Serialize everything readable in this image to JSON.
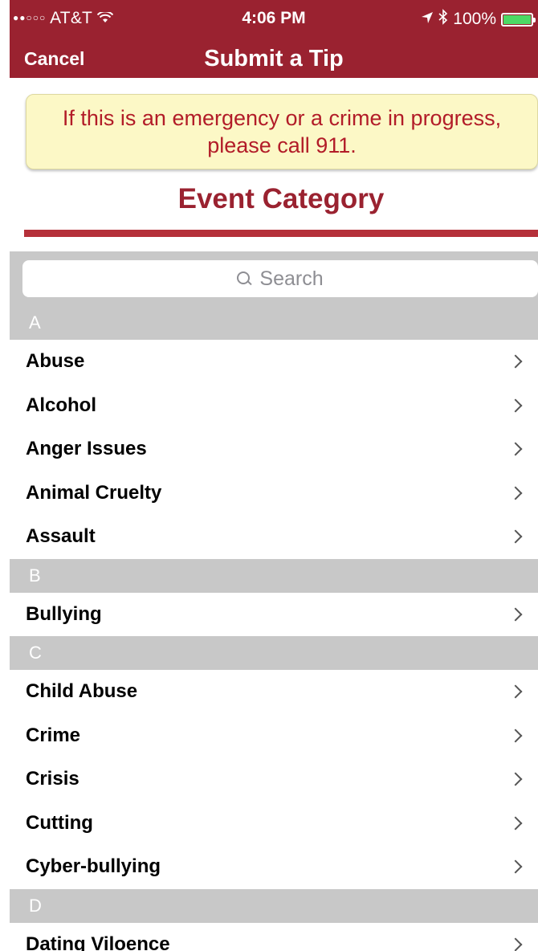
{
  "status_bar": {
    "carrier": "AT&T",
    "time": "4:06 PM",
    "battery": "100%",
    "battery_color": "#4cd964"
  },
  "nav": {
    "cancel_label": "Cancel",
    "title": "Submit a Tip",
    "bar_color": "#9a2230"
  },
  "alert": {
    "line1": "If this is an emergency or a crime in progress,",
    "line2": "please call 911."
  },
  "section_title": "Event Category",
  "search": {
    "placeholder": "Search"
  },
  "sections": [
    {
      "letter": "A",
      "items": [
        "Abuse",
        "Alcohol",
        "Anger Issues",
        "Animal Cruelty",
        "Assault"
      ]
    },
    {
      "letter": "B",
      "items": [
        "Bullying"
      ]
    },
    {
      "letter": "C",
      "items": [
        "Child Abuse",
        "Crime",
        "Crisis",
        "Cutting",
        "Cyber-bullying"
      ]
    },
    {
      "letter": "D",
      "items": [
        "Dating Viloence"
      ]
    }
  ],
  "icons": {
    "wifi": "wifi-icon",
    "location": "location-arrow-icon",
    "bluetooth": "bluetooth-icon",
    "battery": "battery-icon",
    "search": "search-icon",
    "chevron": "chevron-right-icon"
  }
}
